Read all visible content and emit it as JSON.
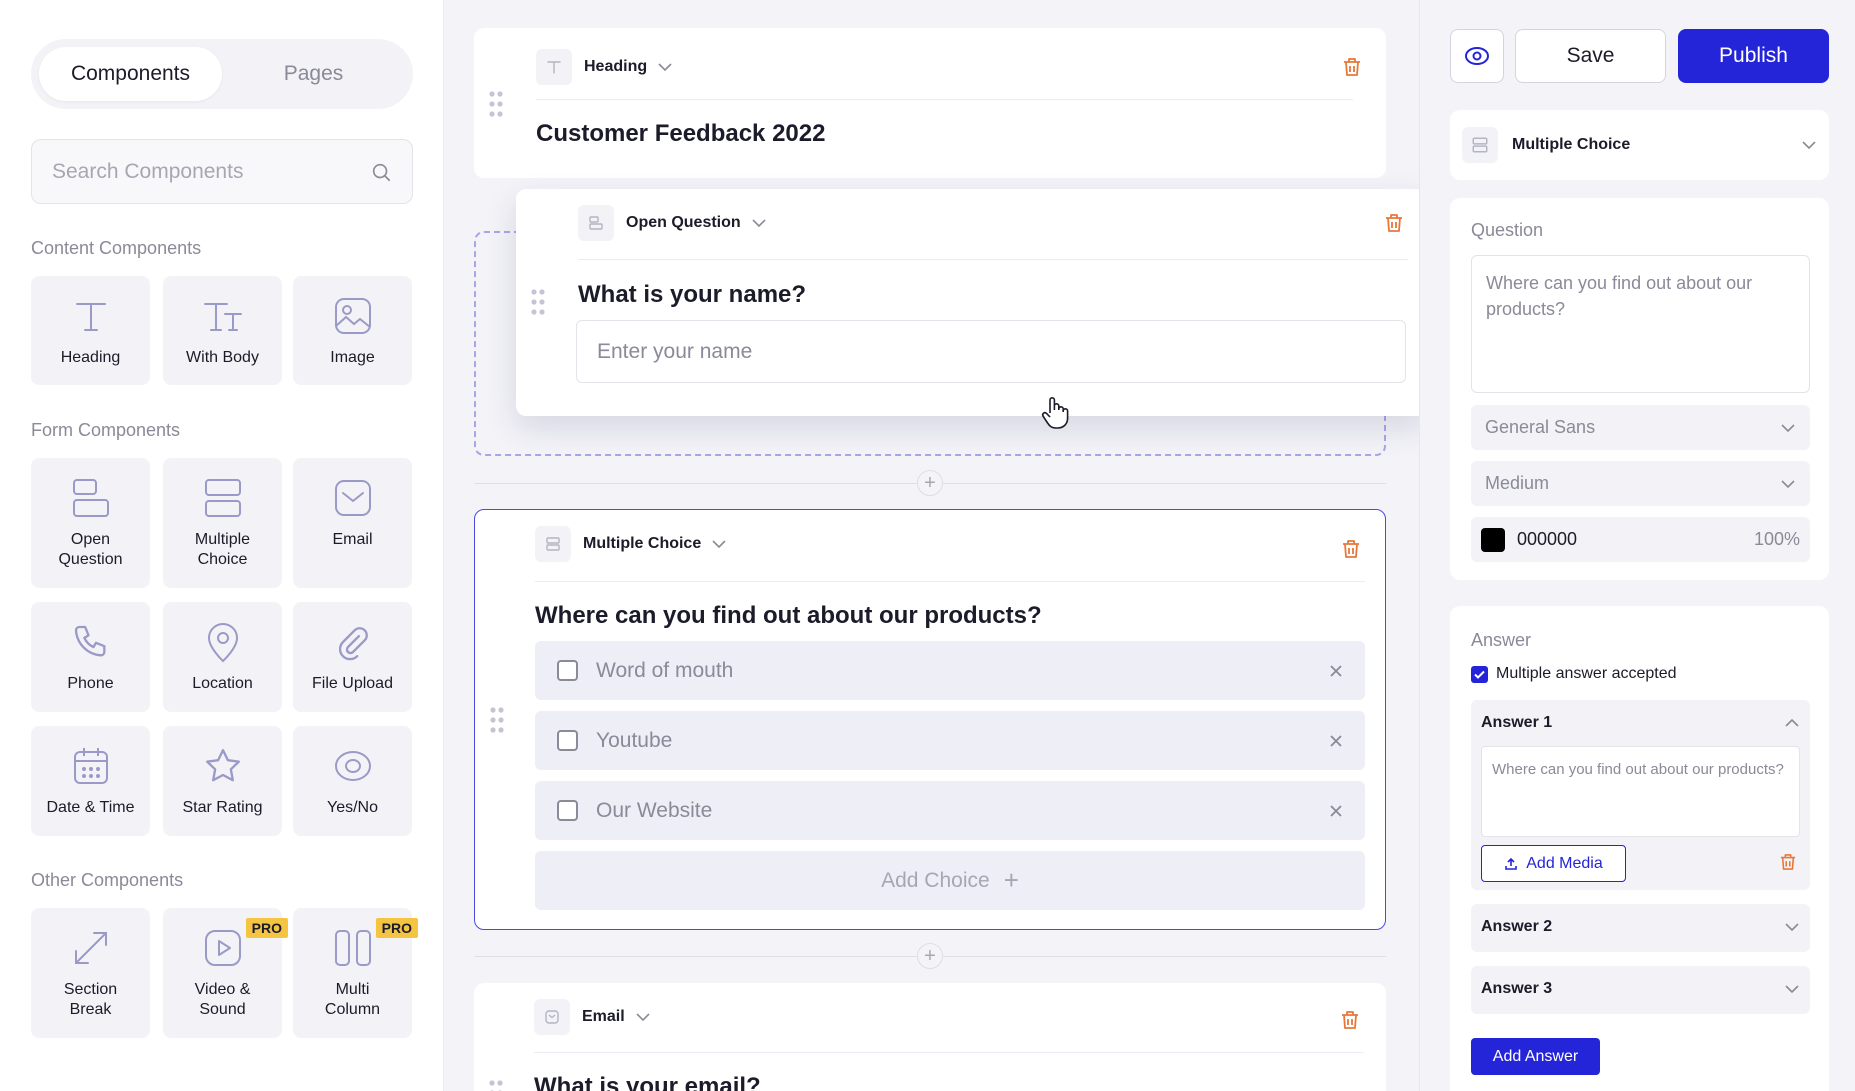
{
  "sidebar": {
    "tabs": [
      "Components",
      "Pages"
    ],
    "search_placeholder": "Search Components",
    "content_title": "Content Components",
    "content_items": [
      "Heading",
      "With Body",
      "Image"
    ],
    "form_title": "Form Components",
    "form_items": [
      "Open\nQuestion",
      "Multiple\nChoice",
      "Email",
      "Phone",
      "Location",
      "File Upload",
      "Date & Time",
      "Star Rating",
      "Yes/No"
    ],
    "other_title": "Other Components",
    "other_items": [
      "Section\nBreak",
      "Video &\nSound",
      "Multi\nColumn"
    ],
    "pro_badge": "PRO"
  },
  "canvas": {
    "heading_card": {
      "type": "Heading",
      "title": "Customer Feedback 2022"
    },
    "open_question_card": {
      "type": "Open Question",
      "title": "What is your name?",
      "placeholder": "Enter your name"
    },
    "multiple_choice_card": {
      "type": "Multiple Choice",
      "title": "Where can you find out about our products?",
      "choices": [
        "Word of mouth",
        "Youtube",
        "Our Website"
      ],
      "add_choice": "Add Choice"
    },
    "email_card": {
      "type": "Email",
      "title": "What is your email?"
    }
  },
  "right_panel": {
    "save": "Save",
    "publish": "Publish",
    "component_type": "Multiple Choice",
    "question_label": "Question",
    "question_text": "Where can you find out about our products?",
    "font_family": "General Sans",
    "font_weight": "Medium",
    "color_hex": "000000",
    "color_opacity": "100%",
    "answer_label": "Answer",
    "multiple_answer": "Multiple answer accepted",
    "answers": [
      "Answer 1",
      "Answer 2",
      "Answer 3"
    ],
    "answer1_text": "Where can you find out about our products?",
    "add_media": "Add Media",
    "add_answer": "Add Answer"
  },
  "colors": {
    "accent": "#2424d8",
    "danger": "#e8773a",
    "pro": "#f5c542"
  },
  "icons": [
    "search-icon",
    "heading-icon",
    "with-body-icon",
    "image-icon",
    "open-question-icon",
    "multiple-choice-icon",
    "email-icon",
    "phone-icon",
    "location-icon",
    "file-upload-icon",
    "date-time-icon",
    "star-icon",
    "yes-no-icon",
    "section-break-icon",
    "video-icon",
    "multi-column-icon",
    "trash-icon",
    "drag-handle-icon",
    "chevron-down-icon",
    "eye-icon",
    "close-icon",
    "plus-icon",
    "upload-icon",
    "hand-cursor-icon"
  ]
}
